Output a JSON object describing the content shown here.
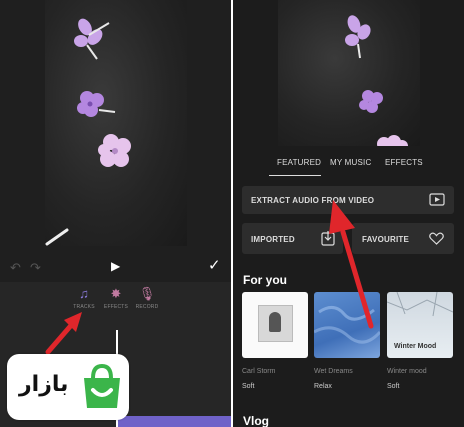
{
  "left": {
    "tools": [
      {
        "label": "TRACKS",
        "icon": "music-note-plus-icon"
      },
      {
        "label": "EFFECTS",
        "icon": "sparkle-icon"
      },
      {
        "label": "RECORD",
        "icon": "microphone-icon"
      }
    ]
  },
  "logo": {
    "text": "بازار"
  },
  "right": {
    "tabs": [
      "FEATURED",
      "MY MUSIC",
      "EFFECTS"
    ],
    "active_tab": "FEATURED",
    "extract_label": "EXTRACT AUDIO FROM VIDEO",
    "imported_label": "IMPORTED",
    "favourite_label": "FAVOURITE",
    "for_you_title": "For you",
    "cards": [
      {
        "title": "Carl Storm",
        "tag": "Soft",
        "caption": ""
      },
      {
        "title": "Wet Dreams",
        "tag": "Relax",
        "caption": ""
      },
      {
        "title": "Winter mood",
        "tag": "Soft",
        "caption": "Winter Mood"
      }
    ],
    "vlog_title": "Vlog"
  },
  "colors": {
    "accent": "#7f6fd0",
    "arrow": "#e0262b",
    "logo_green": "#3bb54a"
  }
}
